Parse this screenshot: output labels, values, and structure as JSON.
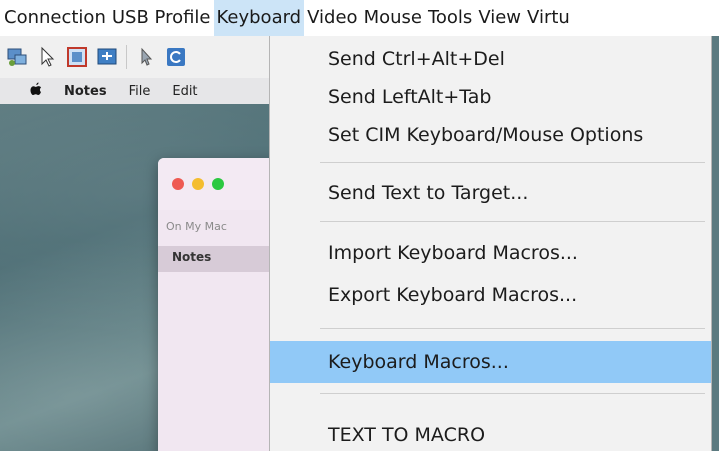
{
  "app_menu": {
    "items": [
      "Connection",
      "USB Profile",
      "Keyboard",
      "Video",
      "Mouse",
      "Tools",
      "View",
      "Virtu"
    ],
    "active": "Keyboard"
  },
  "toolbar": {
    "icons": [
      "connect-icon",
      "pointer-icon",
      "fullscreen-icon",
      "fit-screen-icon",
      "mouse-icon",
      "refresh-icon"
    ]
  },
  "remote_screen": {
    "menubar": {
      "apple": "",
      "items": [
        "Notes",
        "File",
        "Edit"
      ]
    },
    "notes_window": {
      "section": "On My Mac",
      "item": "Notes"
    }
  },
  "keyboard_menu": {
    "items": [
      "Send Ctrl+Alt+Del",
      "Send LeftAlt+Tab",
      "Set CIM Keyboard/Mouse Options",
      "Send Text to Target...",
      "Import Keyboard Macros...",
      "Export Keyboard Macros...",
      "Keyboard Macros...",
      "TEXT TO MACRO"
    ],
    "highlighted": "Keyboard Macros..."
  },
  "colors": {
    "menu_highlight": "#91c9f7",
    "menubar_active": "#cce4f7",
    "menu_bg": "#f2f2f2"
  }
}
